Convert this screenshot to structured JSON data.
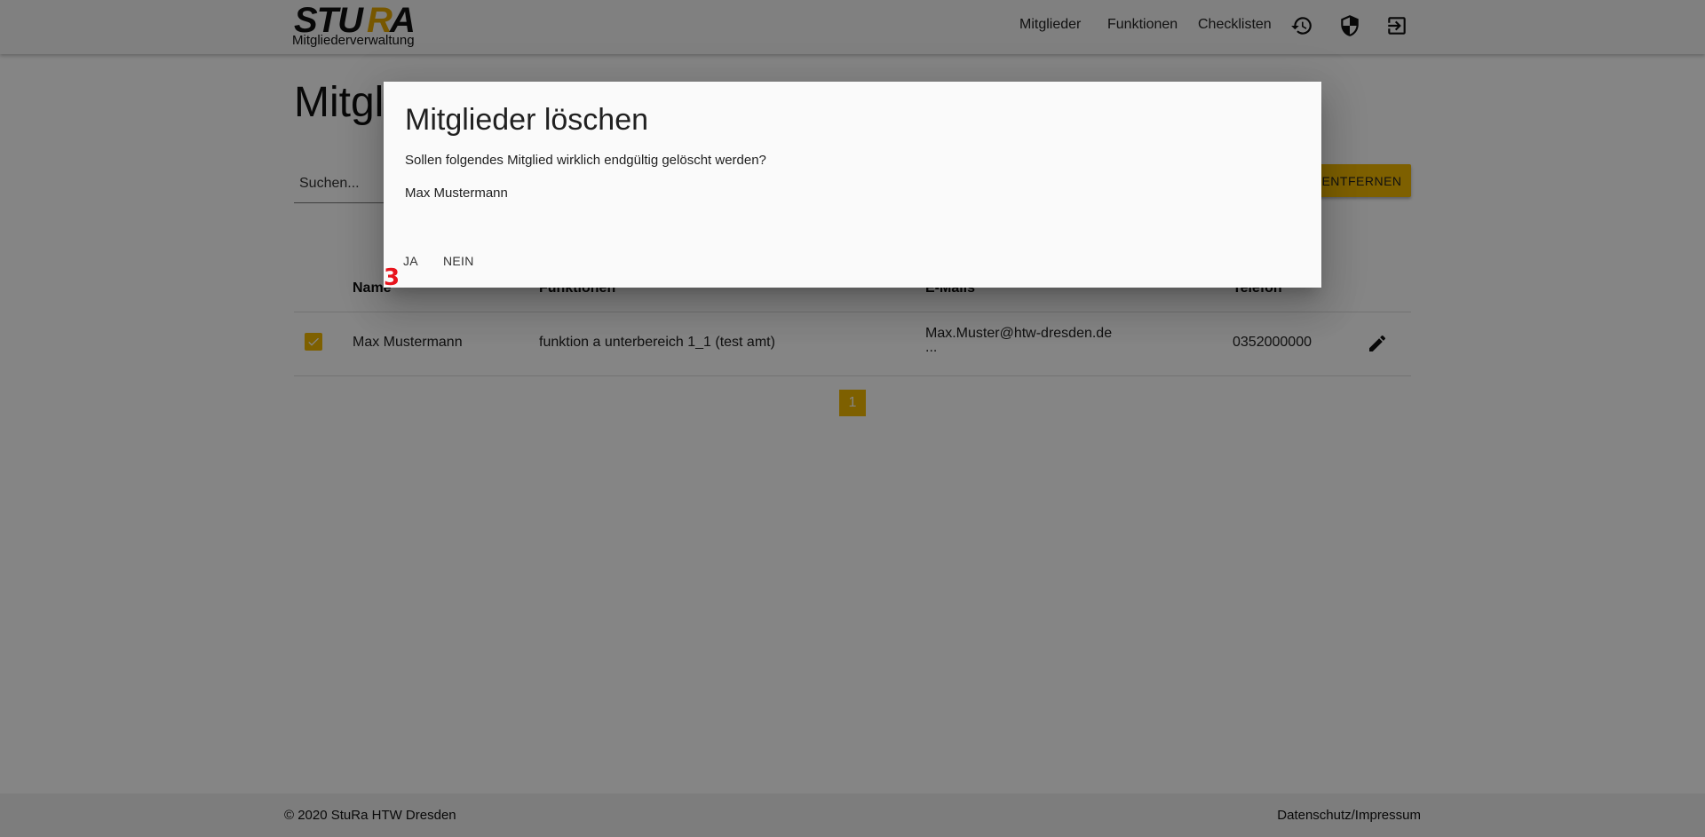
{
  "header": {
    "logo_text": "STURA",
    "subtitle": "Mitgliederverwaltung",
    "nav": [
      "Mitglieder",
      "Funktionen",
      "Checklisten"
    ],
    "icons": [
      "history-icon",
      "shield-icon",
      "logout-icon"
    ]
  },
  "page": {
    "title": "Mitglieder",
    "search_placeholder": "Suchen...",
    "remove_button": "ENTFERNEN",
    "table": {
      "headers": [
        "Name",
        "Funktionen",
        "E-Mails",
        "Telefon"
      ],
      "rows": [
        {
          "checked": true,
          "name": "Max Mustermann",
          "functions": "funktion a unterbereich 1_1 (test amt)",
          "email": "Max.Muster@htw-dresden.de",
          "email_more": "...",
          "phone": "0352000000"
        }
      ]
    },
    "pagination": {
      "current": "1"
    }
  },
  "footer": {
    "copyright": "© 2020 StuRa HTW Dresden",
    "link": "Datenschutz/Impressum"
  },
  "dialog": {
    "title": "Mitglieder löschen",
    "message": "Sollen folgendes Mitglied wirklich endgültig gelöscht werden?",
    "member": "Max Mustermann",
    "yes": "JA",
    "no": "NEIN"
  },
  "annotation": {
    "marker": "3"
  },
  "colors": {
    "accent": "#f2b800",
    "overlay": "rgba(0,0,0,0.48)",
    "marker": "#e8141d"
  }
}
